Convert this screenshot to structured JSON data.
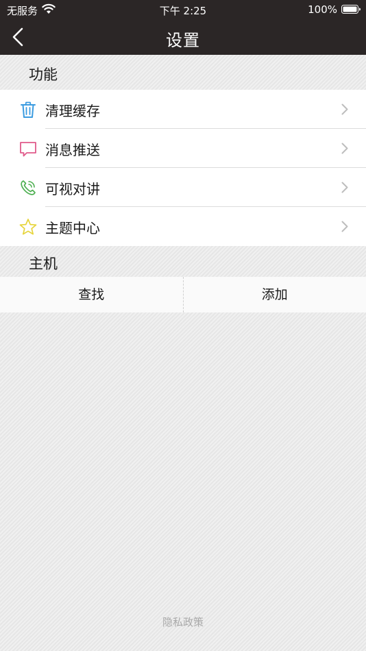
{
  "status_bar": {
    "carrier": "无服务",
    "time": "下午 2:25",
    "battery": "100%"
  },
  "nav": {
    "title": "设置"
  },
  "sections": {
    "function_header": "功能",
    "host_header": "主机"
  },
  "function_items": [
    {
      "label": "清理缓存",
      "icon": "trash-icon",
      "color": "#3a9be0"
    },
    {
      "label": "消息推送",
      "icon": "message-icon",
      "color": "#e05a8a"
    },
    {
      "label": "可视对讲",
      "icon": "phone-icon",
      "color": "#4caf50"
    },
    {
      "label": "主题中心",
      "icon": "star-icon",
      "color": "#e6d43a"
    }
  ],
  "host_buttons": {
    "find": "查找",
    "add": "添加"
  },
  "footer": {
    "privacy": "隐私政策"
  },
  "colors": {
    "nav_bg": "#2b2626",
    "chevron": "#bdbdbd"
  }
}
